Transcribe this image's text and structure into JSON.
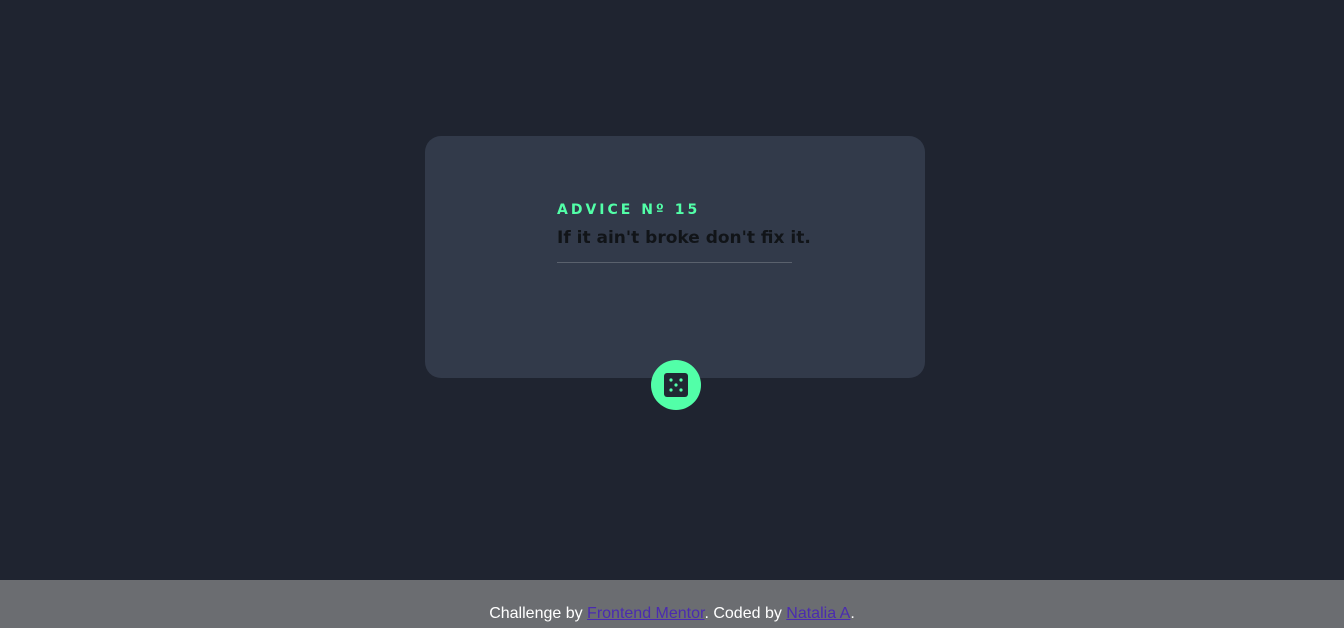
{
  "card": {
    "advice_heading": "ADVICE Nº 15",
    "advice_text": "If it ain't broke don't fix it."
  },
  "dice_button": {
    "icon": "dice-icon",
    "color": "#52ffa8"
  },
  "footer": {
    "prefix": "Challenge by ",
    "link1_text": "Frontend Mentor",
    "middle": ". Coded by ",
    "link2_text": "Natalia A",
    "suffix": "."
  },
  "colors": {
    "background": "#1f2430",
    "card": "#323a4a",
    "accent": "#52ffa8",
    "footer": "#6b6d71",
    "link": "#4a2bb0"
  }
}
